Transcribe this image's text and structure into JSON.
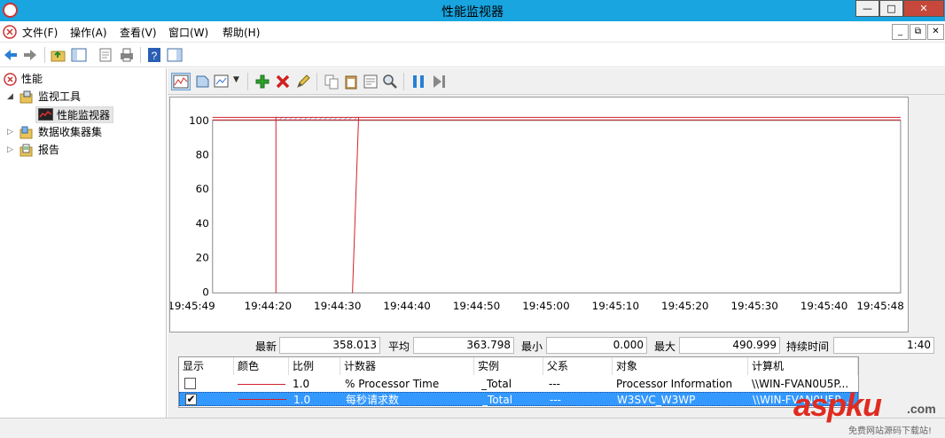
{
  "window": {
    "title": "性能监视器",
    "buttons": {
      "minimize": "—",
      "maximize": "□",
      "close": "✕"
    }
  },
  "menu": {
    "items": [
      "文件(F)",
      "操作(A)",
      "查看(V)",
      "窗口(W)",
      "帮助(H)"
    ],
    "mdi_buttons": [
      "_",
      "⧉",
      "✕"
    ]
  },
  "tree": {
    "root": "性能",
    "items": [
      {
        "label": "监视工具",
        "level": 1,
        "expander": "◢"
      },
      {
        "label": "性能监视器",
        "level": 2,
        "expander": ""
      },
      {
        "label": "数据收集器集",
        "level": 1,
        "expander": "▷"
      },
      {
        "label": "报告",
        "level": 1,
        "expander": "▷"
      }
    ]
  },
  "graph": {
    "y_ticks": [
      "100",
      "80",
      "60",
      "40",
      "20",
      "0"
    ],
    "x_ticks": [
      "19:45:49",
      "19:44:20",
      "19:44:30",
      "19:44:40",
      "19:44:50",
      "19:45:00",
      "19:45:10",
      "19:45:20",
      "19:45:30",
      "19:45:40",
      "19:45:48"
    ]
  },
  "stats": {
    "last_label": "最新",
    "last_value": "358.013",
    "avg_label": "平均",
    "avg_value": "363.798",
    "min_label": "最小",
    "min_value": "0.000",
    "max_label": "最大",
    "max_value": "490.999",
    "duration_label": "持续时间",
    "duration_value": "1:40"
  },
  "legend": {
    "headers": [
      "显示",
      "颜色",
      "比例",
      "计数器",
      "实例",
      "父系",
      "对象",
      "计算机"
    ],
    "rows": [
      {
        "show": false,
        "scale": "1.0",
        "counter": "% Processor Time",
        "instance": "_Total",
        "parent": "---",
        "object": "Processor Information",
        "computer": "\\\\WIN-FVAN0U5P...",
        "color": "#d0202a"
      },
      {
        "show": true,
        "scale": "1.0",
        "counter": "每秒请求数",
        "instance": "_Total",
        "parent": "---",
        "object": "W3SVC_W3WP",
        "computer": "\\\\WIN-FVAN0U5P...",
        "color": "#d0202a"
      }
    ]
  },
  "watermark": {
    "brand": "aspku",
    "domain": ".com",
    "tagline": "免费网站源码下载站!"
  },
  "colors": {
    "titlebar": "#18a5e0",
    "selection": "#3399ff",
    "series": "#d0202a",
    "brand_red": "#e02b20"
  }
}
